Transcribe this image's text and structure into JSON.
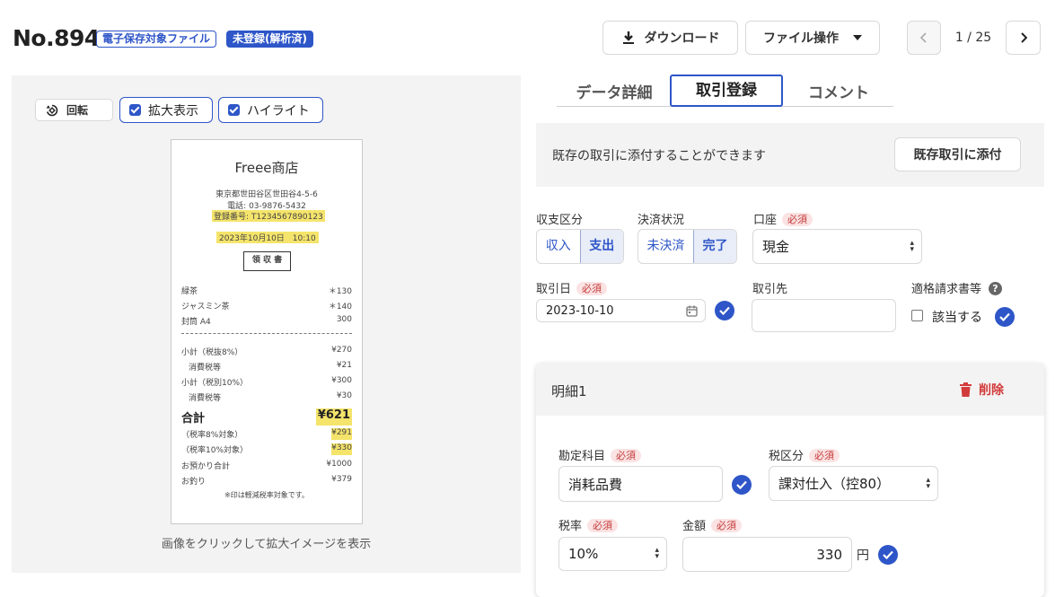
{
  "header": {
    "doc_no": "No.894",
    "badge_storage": "電子保存対象ファイル",
    "badge_status": "未登録(解析済)",
    "download_label": "ダウンロード",
    "file_ops_label": "ファイル操作",
    "pager_text": "1 / 25"
  },
  "viewer": {
    "rotate_label": "回転",
    "zoom_label": "拡大表示",
    "highlight_label": "ハイライト",
    "hint": "画像をクリックして拡大イメージを表示"
  },
  "receipt": {
    "shop": "Freee商店",
    "address": "東京都世田谷区世田谷4-5-6",
    "phone": "電話: 03-9876-5432",
    "reg_no": "登録番号: T1234567890123",
    "datetime": "2023年10月10日　10:10",
    "title": "領 収 書",
    "items": [
      {
        "name": "緑茶",
        "price": "＊130"
      },
      {
        "name": "ジャスミン茶",
        "price": "＊140"
      },
      {
        "name": "封筒 A4",
        "price": "300"
      }
    ],
    "subtotals": [
      {
        "name": "小計（税抜8%）",
        "price": "¥270",
        "indent": false
      },
      {
        "name": "消費税等",
        "price": "¥21",
        "indent": true
      },
      {
        "name": "小計（税別10%）",
        "price": "¥300",
        "indent": false
      },
      {
        "name": "消費税等",
        "price": "¥30",
        "indent": true
      }
    ],
    "total_label": "合計",
    "total_value": "¥621",
    "breakdown": [
      {
        "name": "（税率8%対象）",
        "price": "¥291"
      },
      {
        "name": "（税率10%対象）",
        "price": "¥330"
      },
      {
        "name": "お預かり合計",
        "price": "¥1000"
      },
      {
        "name": "お釣り",
        "price": "¥379"
      }
    ],
    "note": "※印は軽減税率対象です。"
  },
  "tabs": [
    {
      "label": "データ詳細",
      "active": false
    },
    {
      "label": "取引登録",
      "active": true
    },
    {
      "label": "コメント",
      "active": false
    }
  ],
  "attach": {
    "text": "既存の取引に添付することができます",
    "button": "既存取引に添付"
  },
  "form": {
    "kind_label": "収支区分",
    "kind_options": [
      "収入",
      "支出"
    ],
    "kind_selected": "支出",
    "settle_label": "決済状況",
    "settle_options": [
      "未決済",
      "完了"
    ],
    "settle_selected": "完了",
    "account_label": "口座",
    "account_value": "現金",
    "required": "必須",
    "date_label": "取引日",
    "date_value": "2023-10-10",
    "partner_label": "取引先",
    "partner_value": "",
    "invoice_label": "適格請求書等",
    "invoice_checkbox_label": "該当する"
  },
  "detail": {
    "title": "明細1",
    "delete_label": "削除",
    "subject_label": "勘定科目",
    "subject_value": "消耗品費",
    "tax_cat_label": "税区分",
    "tax_cat_value": "課対仕入（控80）",
    "tax_rate_label": "税率",
    "tax_rate_value": "10%",
    "amount_label": "金額",
    "amount_value": "330",
    "amount_unit": "円"
  },
  "colors": {
    "accent": "#2e56c8",
    "danger": "#d23b3b",
    "panel_bg": "#f4f3f3",
    "highlight": "#f5e46b"
  }
}
